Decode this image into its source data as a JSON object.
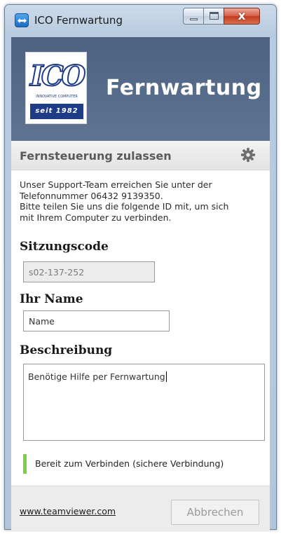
{
  "window": {
    "title": "ICO Fernwartung",
    "close_glyph": "x"
  },
  "header": {
    "logo_mark": "ICO",
    "logo_tagline": "INNOVATIVE COMPUTER",
    "logo_since": "seit 1982",
    "title": "Fernwartung"
  },
  "section": {
    "title": "Fernsteuerung zulassen",
    "settings_icon": "gear-icon"
  },
  "info": {
    "line1": "Unser Support-Team erreichen Sie unter der",
    "line2": "Telefonnummer 06432 9139350.",
    "line3": "Bitte teilen Sie uns die folgende ID mit, um sich",
    "line4": "mit Ihrem Computer zu verbinden."
  },
  "session": {
    "label": "Sitzungscode",
    "value": "s02-137-252"
  },
  "name": {
    "label": "Ihr Name",
    "value": "Name"
  },
  "description": {
    "label": "Beschreibung",
    "value": "Benötige Hilfe per Fernwartung"
  },
  "status": {
    "text": "Bereit zum Verbinden (sichere Verbindung)",
    "color": "#7bd13a"
  },
  "footer": {
    "link": "www.teamviewer.com",
    "cancel_label": "Abbrechen"
  }
}
